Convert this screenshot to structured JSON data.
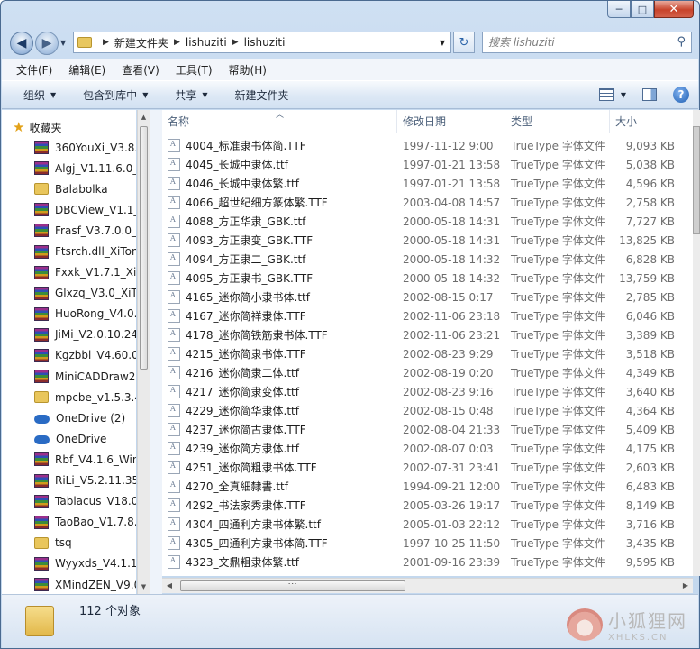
{
  "window": {
    "caption": {
      "minimize": "─",
      "maximize": "□",
      "close": "✕"
    }
  },
  "nav": {
    "back_icon": "back-arrow-icon",
    "forward_icon": "forward-arrow-icon",
    "breadcrumb": [
      "新建文件夹",
      "lishuziti",
      "lishuziti"
    ],
    "search_placeholder": "搜索 lishuziti"
  },
  "menubar": [
    "文件(F)",
    "编辑(E)",
    "查看(V)",
    "工具(T)",
    "帮助(H)"
  ],
  "commandbar": {
    "organize": "组织",
    "include_in_library": "包含到库中",
    "share": "共享",
    "new_folder": "新建文件夹"
  },
  "navpane": {
    "favorites_label": "收藏夹",
    "items": [
      {
        "label": "360YouXi_V3.8.",
        "icon": "rar"
      },
      {
        "label": "Algj_V1.11.6.0_X",
        "icon": "rar"
      },
      {
        "label": "Balabolka",
        "icon": "folder"
      },
      {
        "label": "DBCView_V1.1_",
        "icon": "rar"
      },
      {
        "label": "Frasf_V3.7.0.0_X",
        "icon": "rar"
      },
      {
        "label": "Ftsrch.dll_XiTon",
        "icon": "rar"
      },
      {
        "label": "Fxxk_V1.7.1_XiT",
        "icon": "rar"
      },
      {
        "label": "Glxzq_V3.0_XiTo",
        "icon": "rar"
      },
      {
        "label": "HuoRong_V4.0.",
        "icon": "rar"
      },
      {
        "label": "JiMi_V2.0.10.24_",
        "icon": "rar"
      },
      {
        "label": "Kgzbbl_V4.60.0",
        "icon": "rar"
      },
      {
        "label": "MiniCADDraw20",
        "icon": "rar"
      },
      {
        "label": "mpcbe_v1.5.3.4",
        "icon": "folder"
      },
      {
        "label": "OneDrive (2)",
        "icon": "cloud"
      },
      {
        "label": "OneDrive",
        "icon": "cloud"
      },
      {
        "label": "Rbf_V4.1.6_Win",
        "icon": "rar"
      },
      {
        "label": "RiLi_V5.2.11.354",
        "icon": "rar"
      },
      {
        "label": "Tablacus_V18.0",
        "icon": "rar"
      },
      {
        "label": "TaoBao_V1.7.8.",
        "icon": "rar"
      },
      {
        "label": "tsq",
        "icon": "folder"
      },
      {
        "label": "Wyyxds_V4.1.1.",
        "icon": "rar"
      },
      {
        "label": "XMindZEN_V9.0",
        "icon": "rar"
      }
    ]
  },
  "columns": {
    "name": "名称",
    "date": "修改日期",
    "type": "类型",
    "size": "大小"
  },
  "files": [
    {
      "name": "4004_标准隶书体简.TTF",
      "date": "1997-11-12 9:00",
      "type": "TrueType 字体文件",
      "size": "9,093 KB"
    },
    {
      "name": "4045_长城中隶体.ttf",
      "date": "1997-01-21 13:58",
      "type": "TrueType 字体文件",
      "size": "5,038 KB"
    },
    {
      "name": "4046_长城中隶体繁.ttf",
      "date": "1997-01-21 13:58",
      "type": "TrueType 字体文件",
      "size": "4,596 KB"
    },
    {
      "name": "4066_超世纪细方篆体繁.TTF",
      "date": "2003-04-08 14:57",
      "type": "TrueType 字体文件",
      "size": "2,758 KB"
    },
    {
      "name": "4088_方正华隶_GBK.ttf",
      "date": "2000-05-18 14:31",
      "type": "TrueType 字体文件",
      "size": "7,727 KB"
    },
    {
      "name": "4093_方正隶变_GBK.TTF",
      "date": "2000-05-18 14:31",
      "type": "TrueType 字体文件",
      "size": "13,825 KB"
    },
    {
      "name": "4094_方正隶二_GBK.ttf",
      "date": "2000-05-18 14:32",
      "type": "TrueType 字体文件",
      "size": "6,828 KB"
    },
    {
      "name": "4095_方正隶书_GBK.TTF",
      "date": "2000-05-18 14:32",
      "type": "TrueType 字体文件",
      "size": "13,759 KB"
    },
    {
      "name": "4165_迷你简小隶书体.ttf",
      "date": "2002-08-15 0:17",
      "type": "TrueType 字体文件",
      "size": "2,785 KB"
    },
    {
      "name": "4167_迷你简祥隶体.TTF",
      "date": "2002-11-06 23:18",
      "type": "TrueType 字体文件",
      "size": "6,046 KB"
    },
    {
      "name": "4178_迷你简铁筋隶书体.TTF",
      "date": "2002-11-06 23:21",
      "type": "TrueType 字体文件",
      "size": "3,389 KB"
    },
    {
      "name": "4215_迷你简隶书体.TTF",
      "date": "2002-08-23 9:29",
      "type": "TrueType 字体文件",
      "size": "3,518 KB"
    },
    {
      "name": "4216_迷你简隶二体.ttf",
      "date": "2002-08-19 0:20",
      "type": "TrueType 字体文件",
      "size": "4,349 KB"
    },
    {
      "name": "4217_迷你简隶变体.ttf",
      "date": "2002-08-23 9:16",
      "type": "TrueType 字体文件",
      "size": "3,640 KB"
    },
    {
      "name": "4229_迷你简华隶体.ttf",
      "date": "2002-08-15 0:48",
      "type": "TrueType 字体文件",
      "size": "4,364 KB"
    },
    {
      "name": "4237_迷你简古隶体.TTF",
      "date": "2002-08-04 21:33",
      "type": "TrueType 字体文件",
      "size": "5,409 KB"
    },
    {
      "name": "4239_迷你简方隶体.ttf",
      "date": "2002-08-07 0:03",
      "type": "TrueType 字体文件",
      "size": "4,175 KB"
    },
    {
      "name": "4251_迷你简粗隶书体.TTF",
      "date": "2002-07-31 23:41",
      "type": "TrueType 字体文件",
      "size": "2,603 KB"
    },
    {
      "name": "4270_全真細隸書.ttf",
      "date": "1994-09-21 12:00",
      "type": "TrueType 字体文件",
      "size": "6,483 KB"
    },
    {
      "name": "4292_书法家秀隶体.TTF",
      "date": "2005-03-26 19:17",
      "type": "TrueType 字体文件",
      "size": "8,149 KB"
    },
    {
      "name": "4304_四通利方隶书体繁.ttf",
      "date": "2005-01-03 22:12",
      "type": "TrueType 字体文件",
      "size": "3,716 KB"
    },
    {
      "name": "4305_四通利方隶书体简.TTF",
      "date": "1997-10-25 11:50",
      "type": "TrueType 字体文件",
      "size": "3,435 KB"
    },
    {
      "name": "4323_文鼎粗隶体繁.ttf",
      "date": "2001-09-16 23:39",
      "type": "TrueType 字体文件",
      "size": "9,595 KB"
    }
  ],
  "status": {
    "count": "112 个对象"
  },
  "watermark": {
    "cn": "小狐狸网",
    "en": "XHLKS.CN"
  }
}
